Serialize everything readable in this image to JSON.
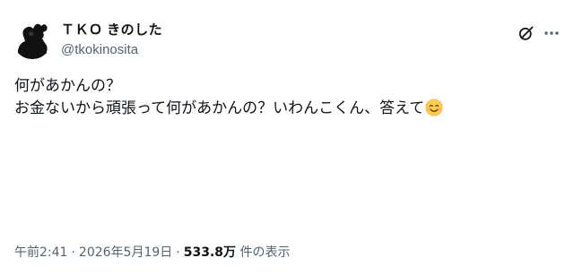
{
  "author": {
    "display_name": "ＴＫＯ きのした",
    "handle": "@tkokinosita"
  },
  "tweet": {
    "line1": "何があかんの？",
    "line2": "お金ないから頑張って何があかんの？いわんこくん、答えて",
    "emoji": "smiling-face-icon"
  },
  "meta": {
    "time": "午前2:41",
    "separator": "·",
    "date": "2026年5月19日",
    "views_count": "533.8万",
    "views_label": " 件の表示"
  },
  "icons": {
    "grok": "grok-icon",
    "more": "more-icon"
  }
}
